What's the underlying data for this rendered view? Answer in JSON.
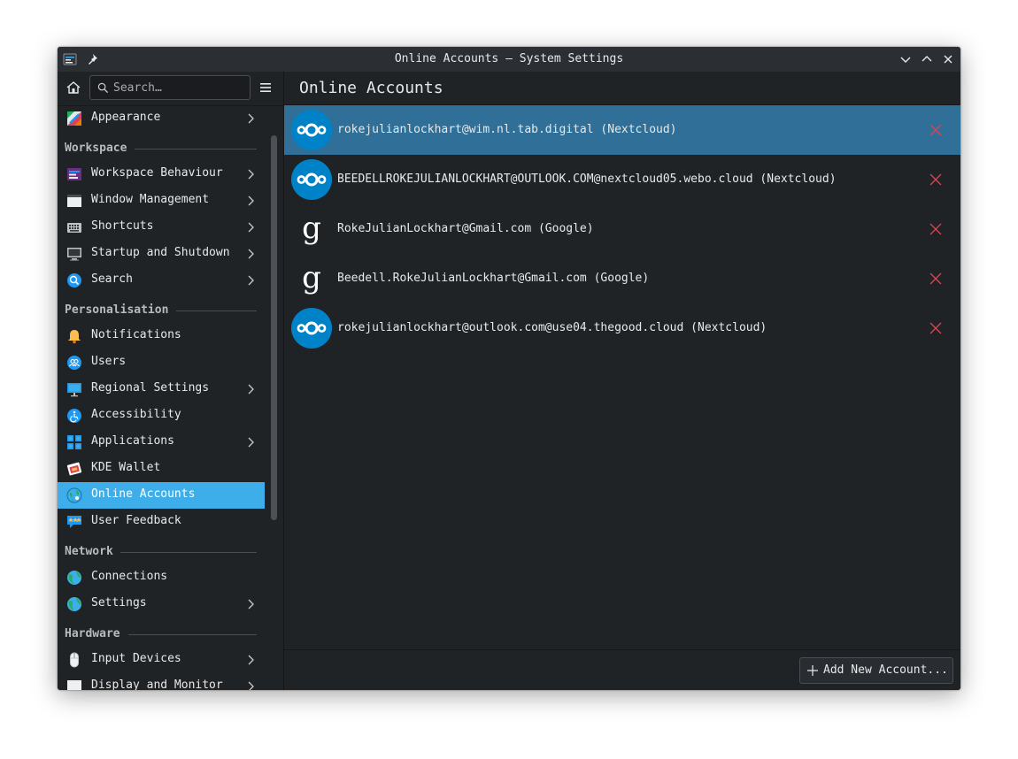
{
  "window": {
    "title": "Online Accounts — System Settings"
  },
  "sidebar": {
    "search_placeholder": "Search…",
    "top_item": {
      "label": "Appearance",
      "icon": "appearance-icon"
    },
    "sections": {
      "workspace": "Workspace",
      "personalisation": "Personalisation",
      "network": "Network",
      "hardware": "Hardware"
    },
    "items": [
      {
        "label": "Workspace Behaviour",
        "icon": "workspace-behaviour-icon"
      },
      {
        "label": "Window Management",
        "icon": "window-management-icon"
      },
      {
        "label": "Shortcuts",
        "icon": "keyboard-icon"
      },
      {
        "label": "Startup and Shutdown",
        "icon": "startup-icon"
      },
      {
        "label": "Search",
        "icon": "search-icon"
      },
      {
        "label": "Notifications",
        "icon": "bell-icon"
      },
      {
        "label": "Users",
        "icon": "users-icon"
      },
      {
        "label": "Regional Settings",
        "icon": "regional-icon"
      },
      {
        "label": "Accessibility",
        "icon": "accessibility-icon"
      },
      {
        "label": "Applications",
        "icon": "applications-icon"
      },
      {
        "label": "KDE Wallet",
        "icon": "wallet-icon"
      },
      {
        "label": "Online Accounts",
        "icon": "online-accounts-icon"
      },
      {
        "label": "User Feedback",
        "icon": "feedback-icon"
      },
      {
        "label": "Connections",
        "icon": "globe-icon"
      },
      {
        "label": "Settings",
        "icon": "globe-icon"
      },
      {
        "label": "Input Devices",
        "icon": "mouse-icon"
      },
      {
        "label": "Display and Monitor",
        "icon": "monitor-icon"
      }
    ]
  },
  "main": {
    "title": "Online Accounts",
    "accounts": [
      {
        "label": "rokejulianlockhart@wim.nl.tab.digital (Nextcloud)",
        "provider": "nextcloud"
      },
      {
        "label": "BEEDELLROKEJULIANLOCKHART@OUTLOOK.COM@nextcloud05.webo.cloud (Nextcloud)",
        "provider": "nextcloud"
      },
      {
        "label": "RokeJulianLockhart@Gmail.com (Google)",
        "provider": "google"
      },
      {
        "label": "Beedell.RokeJulianLockhart@Gmail.com (Google)",
        "provider": "google"
      },
      {
        "label": "rokejulianlockhart@outlook.com@use04.thegood.cloud (Nextcloud)",
        "provider": "nextcloud"
      }
    ],
    "add_button": "Add New Account..."
  },
  "colors": {
    "accent": "#3daee9",
    "selection": "#2f6f98",
    "delete": "#da4453",
    "nextcloud": "#0082c9"
  }
}
